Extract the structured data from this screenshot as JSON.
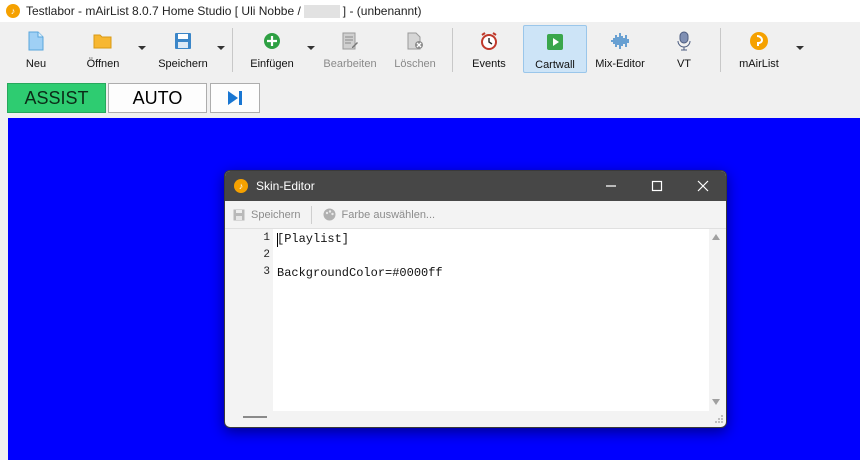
{
  "app": {
    "title_prefix": "Testlabor - mAirList 8.0.7 Home Studio [ Uli Nobbe /",
    "title_suffix": "] - (unbenannt)",
    "logo_glyph": "♪",
    "accent": "#f5a100"
  },
  "toolbar": {
    "new_label": "Neu",
    "open_label": "Öffnen",
    "save_label": "Speichern",
    "insert_label": "Einfügen",
    "edit_label": "Bearbeiten",
    "delete_label": "Löschen",
    "events_label": "Events",
    "cartwall_label": "Cartwall",
    "mixeditor_label": "Mix-Editor",
    "vt_label": "VT",
    "mairlist_label": "mAirList"
  },
  "modes": {
    "assist_label": "ASSIST",
    "auto_label": "AUTO",
    "assist_color": "#2ecc71"
  },
  "main": {
    "background_color": "#0000ff"
  },
  "skin_editor": {
    "title": "Skin-Editor",
    "save_label": "Speichern",
    "color_label": "Farbe auswählen...",
    "lines": [
      {
        "number": "1",
        "text": "[Playlist]"
      },
      {
        "number": "2",
        "text": ""
      },
      {
        "number": "3",
        "text": "BackgroundColor=#0000ff"
      }
    ]
  }
}
